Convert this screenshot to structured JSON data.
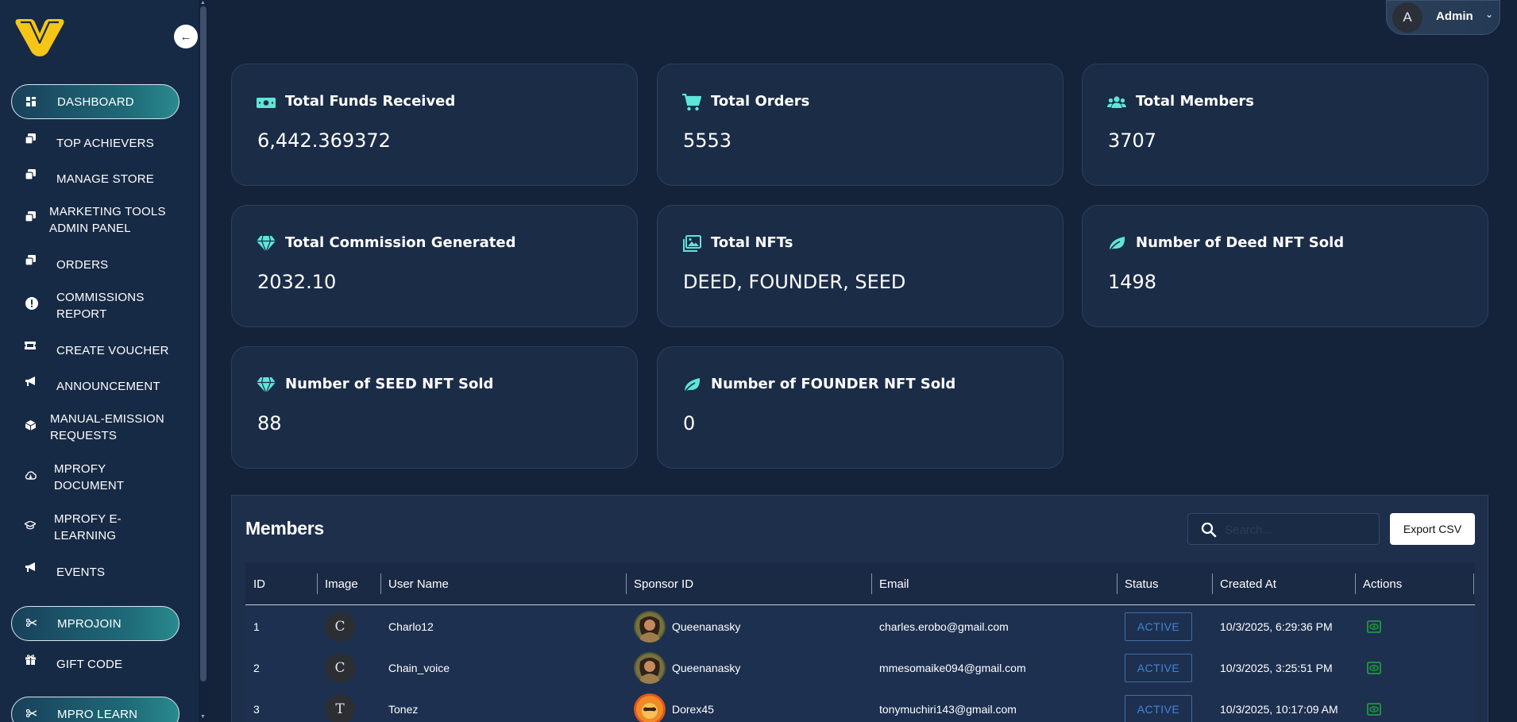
{
  "header": {
    "user_initial": "A",
    "user_name": "Admin"
  },
  "sidebar": {
    "items": [
      {
        "label": "DASHBOARD",
        "icon": "dashboard-icon",
        "active": true
      },
      {
        "label": "TOP ACHIEVERS",
        "icon": "copy-icon"
      },
      {
        "label": "MANAGE STORE",
        "icon": "copy-icon"
      },
      {
        "label": "MARKETING TOOLS ADMIN PANEL",
        "icon": "copy-icon"
      },
      {
        "label": "ORDERS",
        "icon": "copy-icon"
      },
      {
        "label": "COMMISSIONS REPORT",
        "icon": "alert-circle-icon"
      },
      {
        "label": "CREATE VOUCHER",
        "icon": "ticket-icon"
      },
      {
        "label": "ANNOUNCEMENT",
        "icon": "megaphone-icon"
      },
      {
        "label": "MANUAL-EMISSION REQUESTS",
        "icon": "box-icon"
      },
      {
        "label": "MPROFY DOCUMENT",
        "icon": "cloud-icon"
      },
      {
        "label": "MPROFY E-LEARNING",
        "icon": "graduation-cap-icon"
      },
      {
        "label": "EVENTS",
        "icon": "megaphone-icon"
      },
      {
        "label": "MPROJOIN",
        "icon": "scissors-icon",
        "pill": true
      },
      {
        "label": "GIFT CODE",
        "icon": "gift-icon"
      },
      {
        "label": "MPRO LEARN",
        "icon": "scissors-icon",
        "pill": true
      }
    ]
  },
  "stats": [
    {
      "title": "Total Funds Received",
      "value": "6,442.369372",
      "icon": "money-icon"
    },
    {
      "title": "Total Orders",
      "value": "5553",
      "icon": "cart-icon"
    },
    {
      "title": "Total Members",
      "value": "3707",
      "icon": "users-icon"
    },
    {
      "title": "Total Commission Generated",
      "value": "2032.10",
      "icon": "diamond-icon"
    },
    {
      "title": "Total NFTs",
      "value": "DEED, FOUNDER, SEED",
      "icon": "images-icon"
    },
    {
      "title": "Number of Deed NFT Sold",
      "value": "1498",
      "icon": "leaf-icon"
    },
    {
      "title": "Number of SEED NFT Sold",
      "value": "88",
      "icon": "diamond-icon"
    },
    {
      "title": "Number of FOUNDER NFT Sold",
      "value": "0",
      "icon": "leaf-icon"
    }
  ],
  "members": {
    "title": "Members",
    "search_placeholder": "Search...",
    "export_label": "Export CSV",
    "columns": [
      "ID",
      "Image",
      "User Name",
      "Sponsor ID",
      "Email",
      "Status",
      "Created At",
      "Actions"
    ],
    "rows": [
      {
        "id": "1",
        "initial": "C",
        "username": "Charlo12",
        "sponsor": "Queenanasky",
        "email": "charles.erobo@gmail.com",
        "status": "ACTIVE",
        "created": "10/3/2025, 6:29:36 PM"
      },
      {
        "id": "2",
        "initial": "C",
        "username": "Chain_voice",
        "sponsor": "Queenanasky",
        "email": "mmesomaike094@gmail.com",
        "status": "ACTIVE",
        "created": "10/3/2025, 3:25:51 PM"
      },
      {
        "id": "3",
        "initial": "T",
        "username": "Tonez",
        "sponsor": "Dorex45",
        "email": "tonymuchiri143@gmail.com",
        "status": "ACTIVE",
        "created": "10/3/2025, 10:17:09 AM"
      }
    ]
  },
  "colors": {
    "accent": "#5ee6d8",
    "background": "#142339",
    "card": "#1b2c47",
    "logo": "#f5c518"
  }
}
